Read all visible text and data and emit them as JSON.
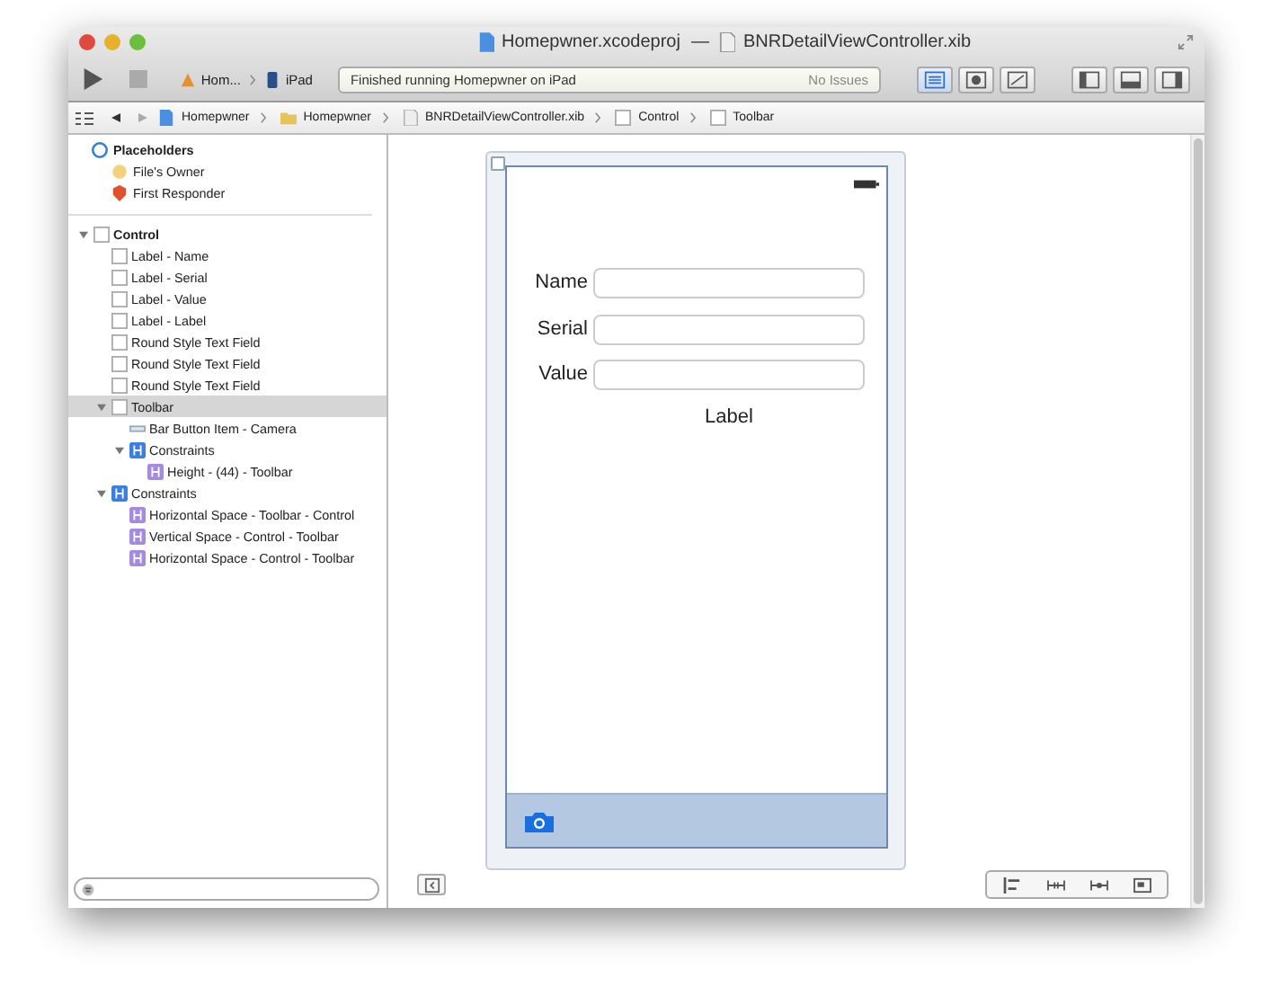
{
  "window": {
    "project": "Homepwner.xcodeproj",
    "separator": "—",
    "file": "BNRDetailViewController.xib"
  },
  "toolbar": {
    "scheme": "Hom...",
    "device": "iPad",
    "status": "Finished running Homepwner on iPad",
    "issues": "No Issues",
    "editors": [
      {
        "kind": "standard",
        "selected": true
      },
      {
        "kind": "assistant",
        "selected": false
      },
      {
        "kind": "version",
        "selected": false
      }
    ],
    "views": [
      {
        "kind": "navigator"
      },
      {
        "kind": "debug"
      },
      {
        "kind": "utilities"
      }
    ]
  },
  "jump_bar": [
    {
      "kind": "project",
      "label": "Homepwner"
    },
    {
      "kind": "folder",
      "label": "Homepwner"
    },
    {
      "kind": "xib",
      "label": "BNRDetailViewController.xib"
    },
    {
      "kind": "view",
      "label": "Control"
    },
    {
      "kind": "view",
      "label": "Toolbar"
    }
  ],
  "outline": {
    "placeholders": {
      "label": "Placeholders",
      "items": [
        {
          "kind": "owner",
          "label": "File's Owner"
        },
        {
          "kind": "responder",
          "label": "First Responder"
        }
      ]
    },
    "items": [
      {
        "kind": "view",
        "label": "Control",
        "expanded": true,
        "selected": false,
        "children": [
          {
            "kind": "view",
            "label": "Label - Name",
            "selected": false
          },
          {
            "kind": "view",
            "label": "Label - Serial",
            "selected": false
          },
          {
            "kind": "view",
            "label": "Label - Value",
            "selected": false
          },
          {
            "kind": "view",
            "label": "Label - Label",
            "selected": false
          },
          {
            "kind": "view",
            "label": "Round Style Text Field",
            "selected": false
          },
          {
            "kind": "view",
            "label": "Round Style Text Field",
            "selected": false
          },
          {
            "kind": "view",
            "label": "Round Style Text Field",
            "selected": false
          },
          {
            "kind": "view",
            "label": "Toolbar",
            "expanded": true,
            "selected": true,
            "children": [
              {
                "kind": "barbutton",
                "label": "Bar Button Item - Camera",
                "selected": false
              },
              {
                "kind": "constraints",
                "label": "Constraints",
                "expanded": true,
                "selected": false,
                "children": [
                  {
                    "kind": "constraint",
                    "label": "Height - (44) - Toolbar",
                    "selected": false
                  }
                ]
              }
            ]
          },
          {
            "kind": "constraints",
            "label": "Constraints",
            "expanded": true,
            "selected": false,
            "children": [
              {
                "kind": "constraint",
                "label": "Horizontal Space - Toolbar - Control",
                "selected": false
              },
              {
                "kind": "constraint",
                "label": "Vertical Space - Control - Toolbar",
                "selected": false
              },
              {
                "kind": "constraint",
                "label": "Horizontal Space - Control - Toolbar",
                "selected": false
              }
            ]
          }
        ]
      }
    ]
  },
  "canvas": {
    "fields": [
      {
        "label": "Name"
      },
      {
        "label": "Serial"
      },
      {
        "label": "Value"
      }
    ],
    "label": "Label"
  }
}
